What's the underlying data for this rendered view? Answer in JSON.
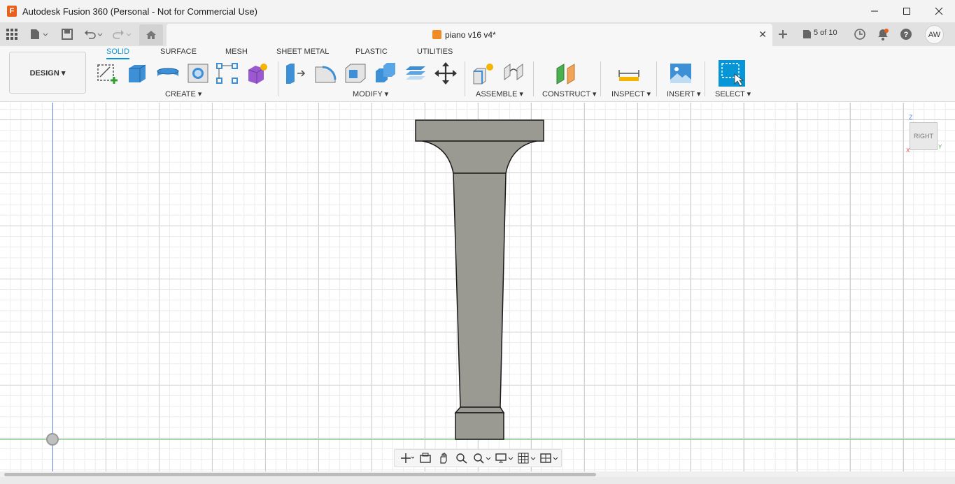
{
  "window": {
    "title": "Autodesk Fusion 360 (Personal - Not for Commercial Use)",
    "logo_letter": "F"
  },
  "tabs": {
    "document_title": "piano v16 v4*",
    "job_status": "5 of 10",
    "user_initials": "AW"
  },
  "toolbar": {
    "workspace": "DESIGN ▾",
    "ribbon_tabs": [
      "SOLID",
      "SURFACE",
      "MESH",
      "SHEET METAL",
      "PLASTIC",
      "UTILITIES"
    ],
    "groups": {
      "create": "CREATE ▾",
      "modify": "MODIFY ▾",
      "assemble": "ASSEMBLE ▾",
      "construct": "CONSTRUCT ▾",
      "inspect": "INSPECT ▾",
      "insert": "INSERT ▾",
      "select": "SELECT ▾"
    }
  },
  "viewcube": {
    "face": "RIGHT",
    "z_label": "Z",
    "y_label": "Y",
    "x_label": "X"
  },
  "colors": {
    "accent": "#0696d7",
    "part_fill": "#9a9a93",
    "part_stroke": "#1a1a1a"
  }
}
